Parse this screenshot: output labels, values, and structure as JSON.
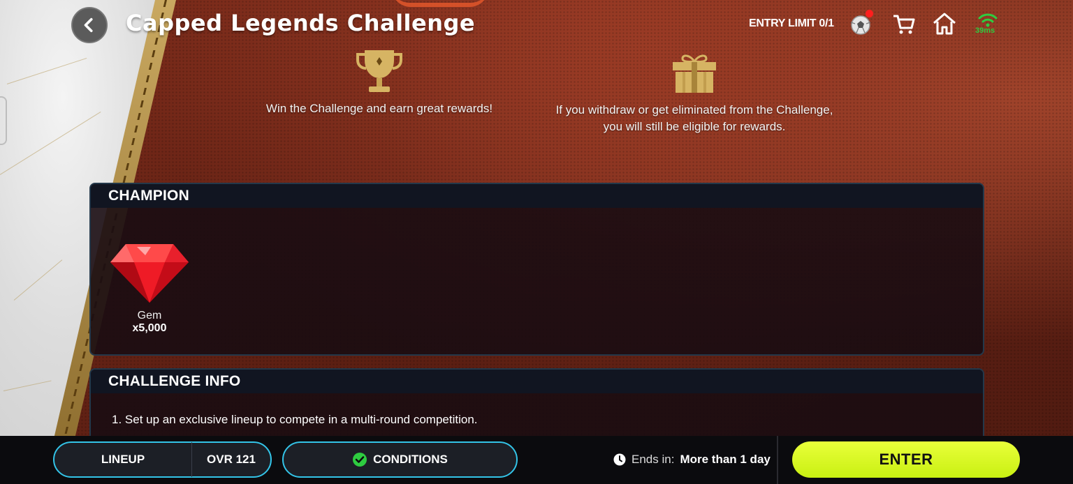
{
  "header": {
    "title": "Capped Legends Challenge",
    "entry_limit": "ENTRY LIMIT 0/1",
    "ping": "39ms"
  },
  "intro": {
    "win_text": "Win the Challenge and earn great rewards!",
    "withdraw_text": "If you withdraw or get eliminated from the Challenge, you will still be eligible for rewards."
  },
  "champion": {
    "heading": "CHAMPION",
    "rewards": [
      {
        "name": "Gem",
        "quantity": "x5,000",
        "icon": "gem-icon"
      }
    ]
  },
  "challenge_info": {
    "heading": "CHALLENGE INFO",
    "lines": [
      "1.  Set up an exclusive lineup to compete in a multi-round competition."
    ]
  },
  "bottom_bar": {
    "lineup_label": "LINEUP",
    "ovr_label": "OVR 121",
    "conditions_label": "CONDITIONS",
    "ends_label": "Ends in:",
    "ends_value": "More than 1 day",
    "enter_label": "ENTER"
  },
  "colors": {
    "accent_cyan": "#33c4e8",
    "enter_green": "#d4f51e",
    "status_green": "#2ecc40",
    "notification_red": "#ff1e1e",
    "gold": "#c9a860"
  }
}
